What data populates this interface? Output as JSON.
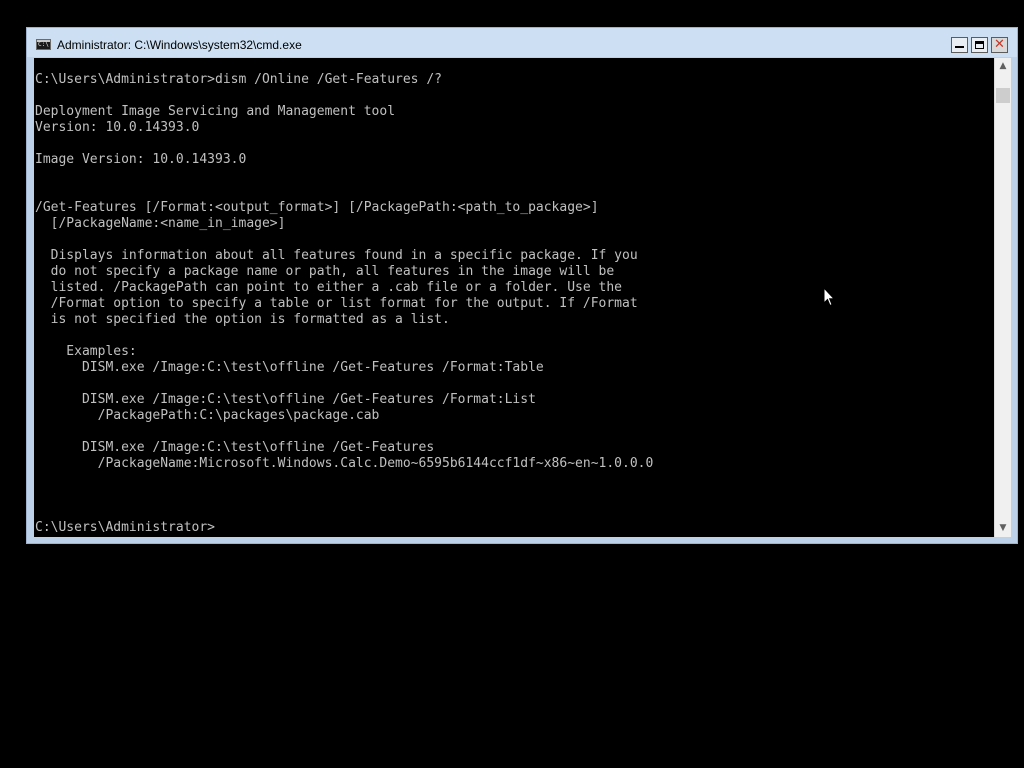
{
  "window": {
    "title": "Administrator: C:\\Windows\\system32\\cmd.exe",
    "icon": "cmd-icon",
    "icon_glyph": "C:\\"
  },
  "controls": {
    "minimize_icon": "minimize-icon",
    "maximize_icon": "maximize-icon",
    "close_icon": "close-icon",
    "close_glyph": "✕"
  },
  "console": {
    "lines": [
      "C:\\Users\\Administrator>dism /Online /Get-Features /?",
      "",
      "Deployment Image Servicing and Management tool",
      "Version: 10.0.14393.0",
      "",
      "Image Version: 10.0.14393.0",
      "",
      "",
      "/Get-Features [/Format:<output_format>] [/PackagePath:<path_to_package>]",
      "  [/PackageName:<name_in_image>]",
      "",
      "  Displays information about all features found in a specific package. If you",
      "  do not specify a package name or path, all features in the image will be",
      "  listed. /PackagePath can point to either a .cab file or a folder. Use the",
      "  /Format option to specify a table or list format for the output. If /Format",
      "  is not specified the option is formatted as a list.",
      "",
      "    Examples:",
      "      DISM.exe /Image:C:\\test\\offline /Get-Features /Format:Table",
      "",
      "      DISM.exe /Image:C:\\test\\offline /Get-Features /Format:List",
      "        /PackagePath:C:\\packages\\package.cab",
      "",
      "      DISM.exe /Image:C:\\test\\offline /Get-Features",
      "        /PackageName:Microsoft.Windows.Calc.Demo~6595b6144ccf1df~x86~en~1.0.0.0",
      "",
      "",
      "",
      "C:\\Users\\Administrator>"
    ]
  },
  "scrollbar": {
    "up_arrow": "▲",
    "down_arrow": "▼"
  },
  "colors": {
    "console_background": "#000000",
    "console_text": "#c0c0c0",
    "titlebar": "#cde0f3",
    "window_frame": "#bdd1e8"
  }
}
